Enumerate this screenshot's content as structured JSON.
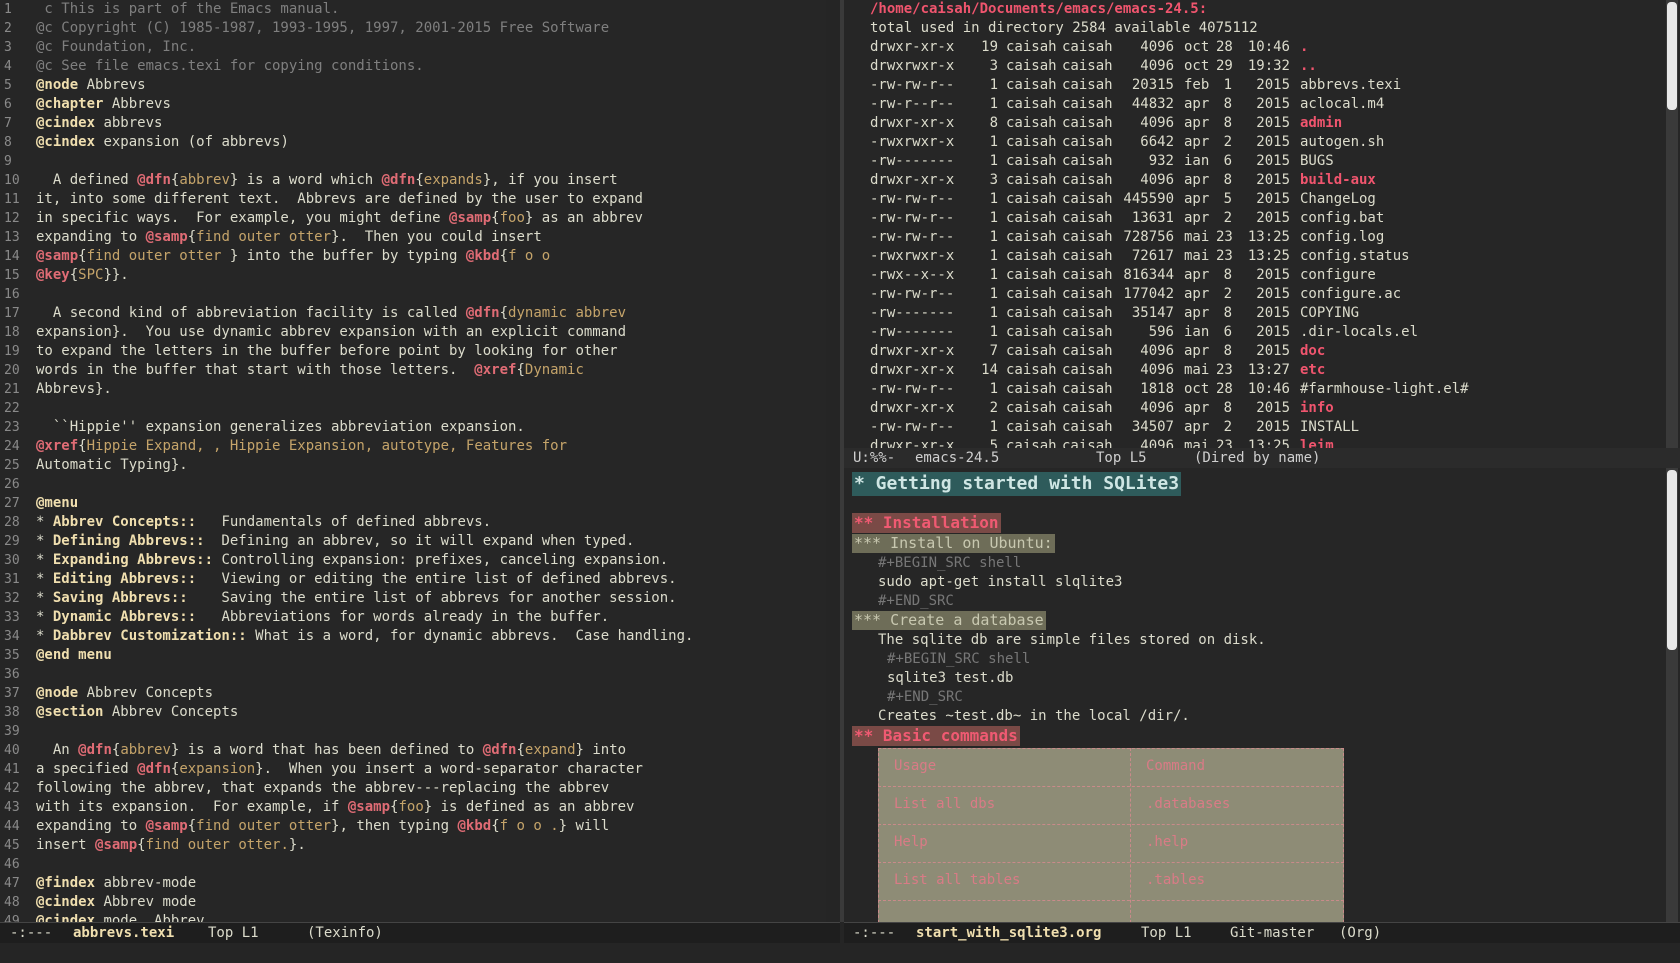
{
  "left_window": {
    "lines": [
      {
        "n": "1",
        "t": " c This is part of the Emacs manual."
      },
      {
        "n": "2",
        "t": "@c Copyright (C) 1985-1987, 1993-1995, 1997, 2001-2015 Free Software"
      },
      {
        "n": "3",
        "t": "@c Foundation, Inc."
      },
      {
        "n": "4",
        "t": "@c See file emacs.texi for copying conditions."
      },
      {
        "n": "5",
        "t": "@node Abbrevs"
      },
      {
        "n": "6",
        "t": "@chapter Abbrevs"
      },
      {
        "n": "7",
        "t": "@cindex abbrevs"
      },
      {
        "n": "8",
        "t": "@cindex expansion (of abbrevs)"
      },
      {
        "n": "9",
        "t": ""
      },
      {
        "n": "10",
        "t": "  A defined @dfn{abbrev} is a word which @dfn{expands}, if you insert"
      },
      {
        "n": "11",
        "t": "it, into some different text.  Abbrevs are defined by the user to expand"
      },
      {
        "n": "12",
        "t": "in specific ways.  For example, you might define @samp{foo} as an abbrev"
      },
      {
        "n": "13",
        "t": "expanding to @samp{find outer otter}.  Then you could insert"
      },
      {
        "n": "14",
        "t": "@samp{find outer otter } into the buffer by typing @kbd{f o o"
      },
      {
        "n": "15",
        "t": "@key{SPC}}."
      },
      {
        "n": "16",
        "t": ""
      },
      {
        "n": "17",
        "t": "  A second kind of abbreviation facility is called @dfn{dynamic abbrev"
      },
      {
        "n": "18",
        "t": "expansion}.  You use dynamic abbrev expansion with an explicit command"
      },
      {
        "n": "19",
        "t": "to expand the letters in the buffer before point by looking for other"
      },
      {
        "n": "20",
        "t": "words in the buffer that start with those letters.  @xref{Dynamic"
      },
      {
        "n": "21",
        "t": "Abbrevs}."
      },
      {
        "n": "22",
        "t": ""
      },
      {
        "n": "23",
        "t": "  ``Hippie'' expansion generalizes abbreviation expansion."
      },
      {
        "n": "24",
        "t": "@xref{Hippie Expand, , Hippie Expansion, autotype, Features for"
      },
      {
        "n": "25",
        "t": "Automatic Typing}."
      },
      {
        "n": "26",
        "t": ""
      },
      {
        "n": "27",
        "t": "@menu"
      },
      {
        "n": "28",
        "t": "* Abbrev Concepts::   Fundamentals of defined abbrevs."
      },
      {
        "n": "29",
        "t": "* Defining Abbrevs::  Defining an abbrev, so it will expand when typed."
      },
      {
        "n": "30",
        "t": "* Expanding Abbrevs:: Controlling expansion: prefixes, canceling expansion."
      },
      {
        "n": "31",
        "t": "* Editing Abbrevs::   Viewing or editing the entire list of defined abbrevs."
      },
      {
        "n": "32",
        "t": "* Saving Abbrevs::    Saving the entire list of abbrevs for another session."
      },
      {
        "n": "33",
        "t": "* Dynamic Abbrevs::   Abbreviations for words already in the buffer."
      },
      {
        "n": "34",
        "t": "* Dabbrev Customization:: What is a word, for dynamic abbrevs.  Case handling."
      },
      {
        "n": "35",
        "t": "@end menu"
      },
      {
        "n": "36",
        "t": ""
      },
      {
        "n": "37",
        "t": "@node Abbrev Concepts"
      },
      {
        "n": "38",
        "t": "@section Abbrev Concepts"
      },
      {
        "n": "39",
        "t": ""
      },
      {
        "n": "40",
        "t": "  An @dfn{abbrev} is a word that has been defined to @dfn{expand} into"
      },
      {
        "n": "41",
        "t": "a specified @dfn{expansion}.  When you insert a word-separator character"
      },
      {
        "n": "42",
        "t": "following the abbrev, that expands the abbrev---replacing the abbrev"
      },
      {
        "n": "43",
        "t": "with its expansion.  For example, if @samp{foo} is defined as an abbrev"
      },
      {
        "n": "44",
        "t": "expanding to @samp{find outer otter}, then typing @kbd{f o o .} will"
      },
      {
        "n": "45",
        "t": "insert @samp{find outer otter.}."
      },
      {
        "n": "46",
        "t": ""
      },
      {
        "n": "47",
        "t": "@findex abbrev-mode"
      },
      {
        "n": "48",
        "t": "@cindex Abbrev mode"
      },
      {
        "n": "49",
        "t": "@cindex mode, Abbrev"
      }
    ],
    "modeline": {
      "status": "-:---",
      "buffer": "abbrevs.texi",
      "pos": "Top L1",
      "mode": "(Texinfo)"
    }
  },
  "dired_window": {
    "header": "/home/caisah/Documents/emacs/emacs-24.5:",
    "total": "total used in directory 2584 available 4075112",
    "rows": [
      {
        "perm": "drwxr-xr-x",
        "links": "19",
        "owner": "caisah",
        "group": "caisah",
        "size": "4096",
        "month": "oct",
        "day": "28",
        "time": "10:46",
        "name": ".",
        "is_dir": true
      },
      {
        "perm": "drwxrwxr-x",
        "links": "3",
        "owner": "caisah",
        "group": "caisah",
        "size": "4096",
        "month": "oct",
        "day": "29",
        "time": "19:32",
        "name": "..",
        "is_dir": true
      },
      {
        "perm": "-rw-rw-r--",
        "links": "1",
        "owner": "caisah",
        "group": "caisah",
        "size": "20315",
        "month": "feb",
        "day": "1",
        "time": "2015",
        "name": "abbrevs.texi",
        "is_dir": false
      },
      {
        "perm": "-rw-r--r--",
        "links": "1",
        "owner": "caisah",
        "group": "caisah",
        "size": "44832",
        "month": "apr",
        "day": "8",
        "time": "2015",
        "name": "aclocal.m4",
        "is_dir": false
      },
      {
        "perm": "drwxr-xr-x",
        "links": "8",
        "owner": "caisah",
        "group": "caisah",
        "size": "4096",
        "month": "apr",
        "day": "8",
        "time": "2015",
        "name": "admin",
        "is_dir": true
      },
      {
        "perm": "-rwxrwxr-x",
        "links": "1",
        "owner": "caisah",
        "group": "caisah",
        "size": "6642",
        "month": "apr",
        "day": "2",
        "time": "2015",
        "name": "autogen.sh",
        "is_dir": false
      },
      {
        "perm": "-rw-------",
        "links": "1",
        "owner": "caisah",
        "group": "caisah",
        "size": "932",
        "month": "ian",
        "day": "6",
        "time": "2015",
        "name": "BUGS",
        "is_dir": false
      },
      {
        "perm": "drwxr-xr-x",
        "links": "3",
        "owner": "caisah",
        "group": "caisah",
        "size": "4096",
        "month": "apr",
        "day": "8",
        "time": "2015",
        "name": "build-aux",
        "is_dir": true
      },
      {
        "perm": "-rw-rw-r--",
        "links": "1",
        "owner": "caisah",
        "group": "caisah",
        "size": "445590",
        "month": "apr",
        "day": "5",
        "time": "2015",
        "name": "ChangeLog",
        "is_dir": false
      },
      {
        "perm": "-rw-rw-r--",
        "links": "1",
        "owner": "caisah",
        "group": "caisah",
        "size": "13631",
        "month": "apr",
        "day": "2",
        "time": "2015",
        "name": "config.bat",
        "is_dir": false
      },
      {
        "perm": "-rw-rw-r--",
        "links": "1",
        "owner": "caisah",
        "group": "caisah",
        "size": "728756",
        "month": "mai",
        "day": "23",
        "time": "13:25",
        "name": "config.log",
        "is_dir": false
      },
      {
        "perm": "-rwxrwxr-x",
        "links": "1",
        "owner": "caisah",
        "group": "caisah",
        "size": "72617",
        "month": "mai",
        "day": "23",
        "time": "13:25",
        "name": "config.status",
        "is_dir": false
      },
      {
        "perm": "-rwx--x--x",
        "links": "1",
        "owner": "caisah",
        "group": "caisah",
        "size": "816344",
        "month": "apr",
        "day": "8",
        "time": "2015",
        "name": "configure",
        "is_dir": false
      },
      {
        "perm": "-rw-rw-r--",
        "links": "1",
        "owner": "caisah",
        "group": "caisah",
        "size": "177042",
        "month": "apr",
        "day": "2",
        "time": "2015",
        "name": "configure.ac",
        "is_dir": false
      },
      {
        "perm": "-rw-------",
        "links": "1",
        "owner": "caisah",
        "group": "caisah",
        "size": "35147",
        "month": "apr",
        "day": "8",
        "time": "2015",
        "name": "COPYING",
        "is_dir": false
      },
      {
        "perm": "-rw-------",
        "links": "1",
        "owner": "caisah",
        "group": "caisah",
        "size": "596",
        "month": "ian",
        "day": "6",
        "time": "2015",
        "name": ".dir-locals.el",
        "is_dir": false
      },
      {
        "perm": "drwxr-xr-x",
        "links": "7",
        "owner": "caisah",
        "group": "caisah",
        "size": "4096",
        "month": "apr",
        "day": "8",
        "time": "2015",
        "name": "doc",
        "is_dir": true
      },
      {
        "perm": "drwxr-xr-x",
        "links": "14",
        "owner": "caisah",
        "group": "caisah",
        "size": "4096",
        "month": "mai",
        "day": "23",
        "time": "13:27",
        "name": "etc",
        "is_dir": true
      },
      {
        "perm": "-rw-rw-r--",
        "links": "1",
        "owner": "caisah",
        "group": "caisah",
        "size": "1818",
        "month": "oct",
        "day": "28",
        "time": "10:46",
        "name": "#farmhouse-light.el#",
        "is_dir": false
      },
      {
        "perm": "drwxr-xr-x",
        "links": "2",
        "owner": "caisah",
        "group": "caisah",
        "size": "4096",
        "month": "apr",
        "day": "8",
        "time": "2015",
        "name": "info",
        "is_dir": true
      },
      {
        "perm": "-rw-rw-r--",
        "links": "1",
        "owner": "caisah",
        "group": "caisah",
        "size": "34507",
        "month": "apr",
        "day": "2",
        "time": "2015",
        "name": "INSTALL",
        "is_dir": false
      },
      {
        "perm": "drwxr-xr-x",
        "links": "5",
        "owner": "caisah",
        "group": "caisah",
        "size": "4096",
        "month": "mai",
        "day": "23",
        "time": "13:25",
        "name": "leim",
        "is_dir": true
      }
    ],
    "modeline": {
      "status": "U:%%-",
      "buffer": "emacs-24.5",
      "pos": "Top L5",
      "mode": "(Dired by name)"
    }
  },
  "org_window": {
    "title": "* Getting started with SQLite3",
    "h2_install": "** Installation",
    "h3_ubuntu": "*** Install on Ubuntu:",
    "src1_begin": "#+BEGIN_SRC shell",
    "src1_code": "sudo apt-get install slqlite3",
    "src1_end": "#+END_SRC",
    "h3_create": "*** Create a database",
    "create_text": "The sqlite db are simple files stored on disk.",
    "src2_begin": "#+BEGIN_SRC shell",
    "src2_code": "sqlite3 test.db",
    "src2_end": "#+END_SRC",
    "creates_text": "Creates ~test.db~ in the local /dir/.",
    "h2_basic": "** Basic commands",
    "table": [
      {
        "usage": "Usage",
        "command": "Command"
      },
      {
        "usage": "List all dbs",
        "command": ".databases"
      },
      {
        "usage": "Help",
        "command": ".help"
      },
      {
        "usage": "List all tables",
        "command": ".tables"
      }
    ],
    "modeline": {
      "status": "-:---",
      "buffer": "start_with_sqlite3.org",
      "pos": "Top L1",
      "vc": "Git-master",
      "mode": "(Org)"
    }
  }
}
